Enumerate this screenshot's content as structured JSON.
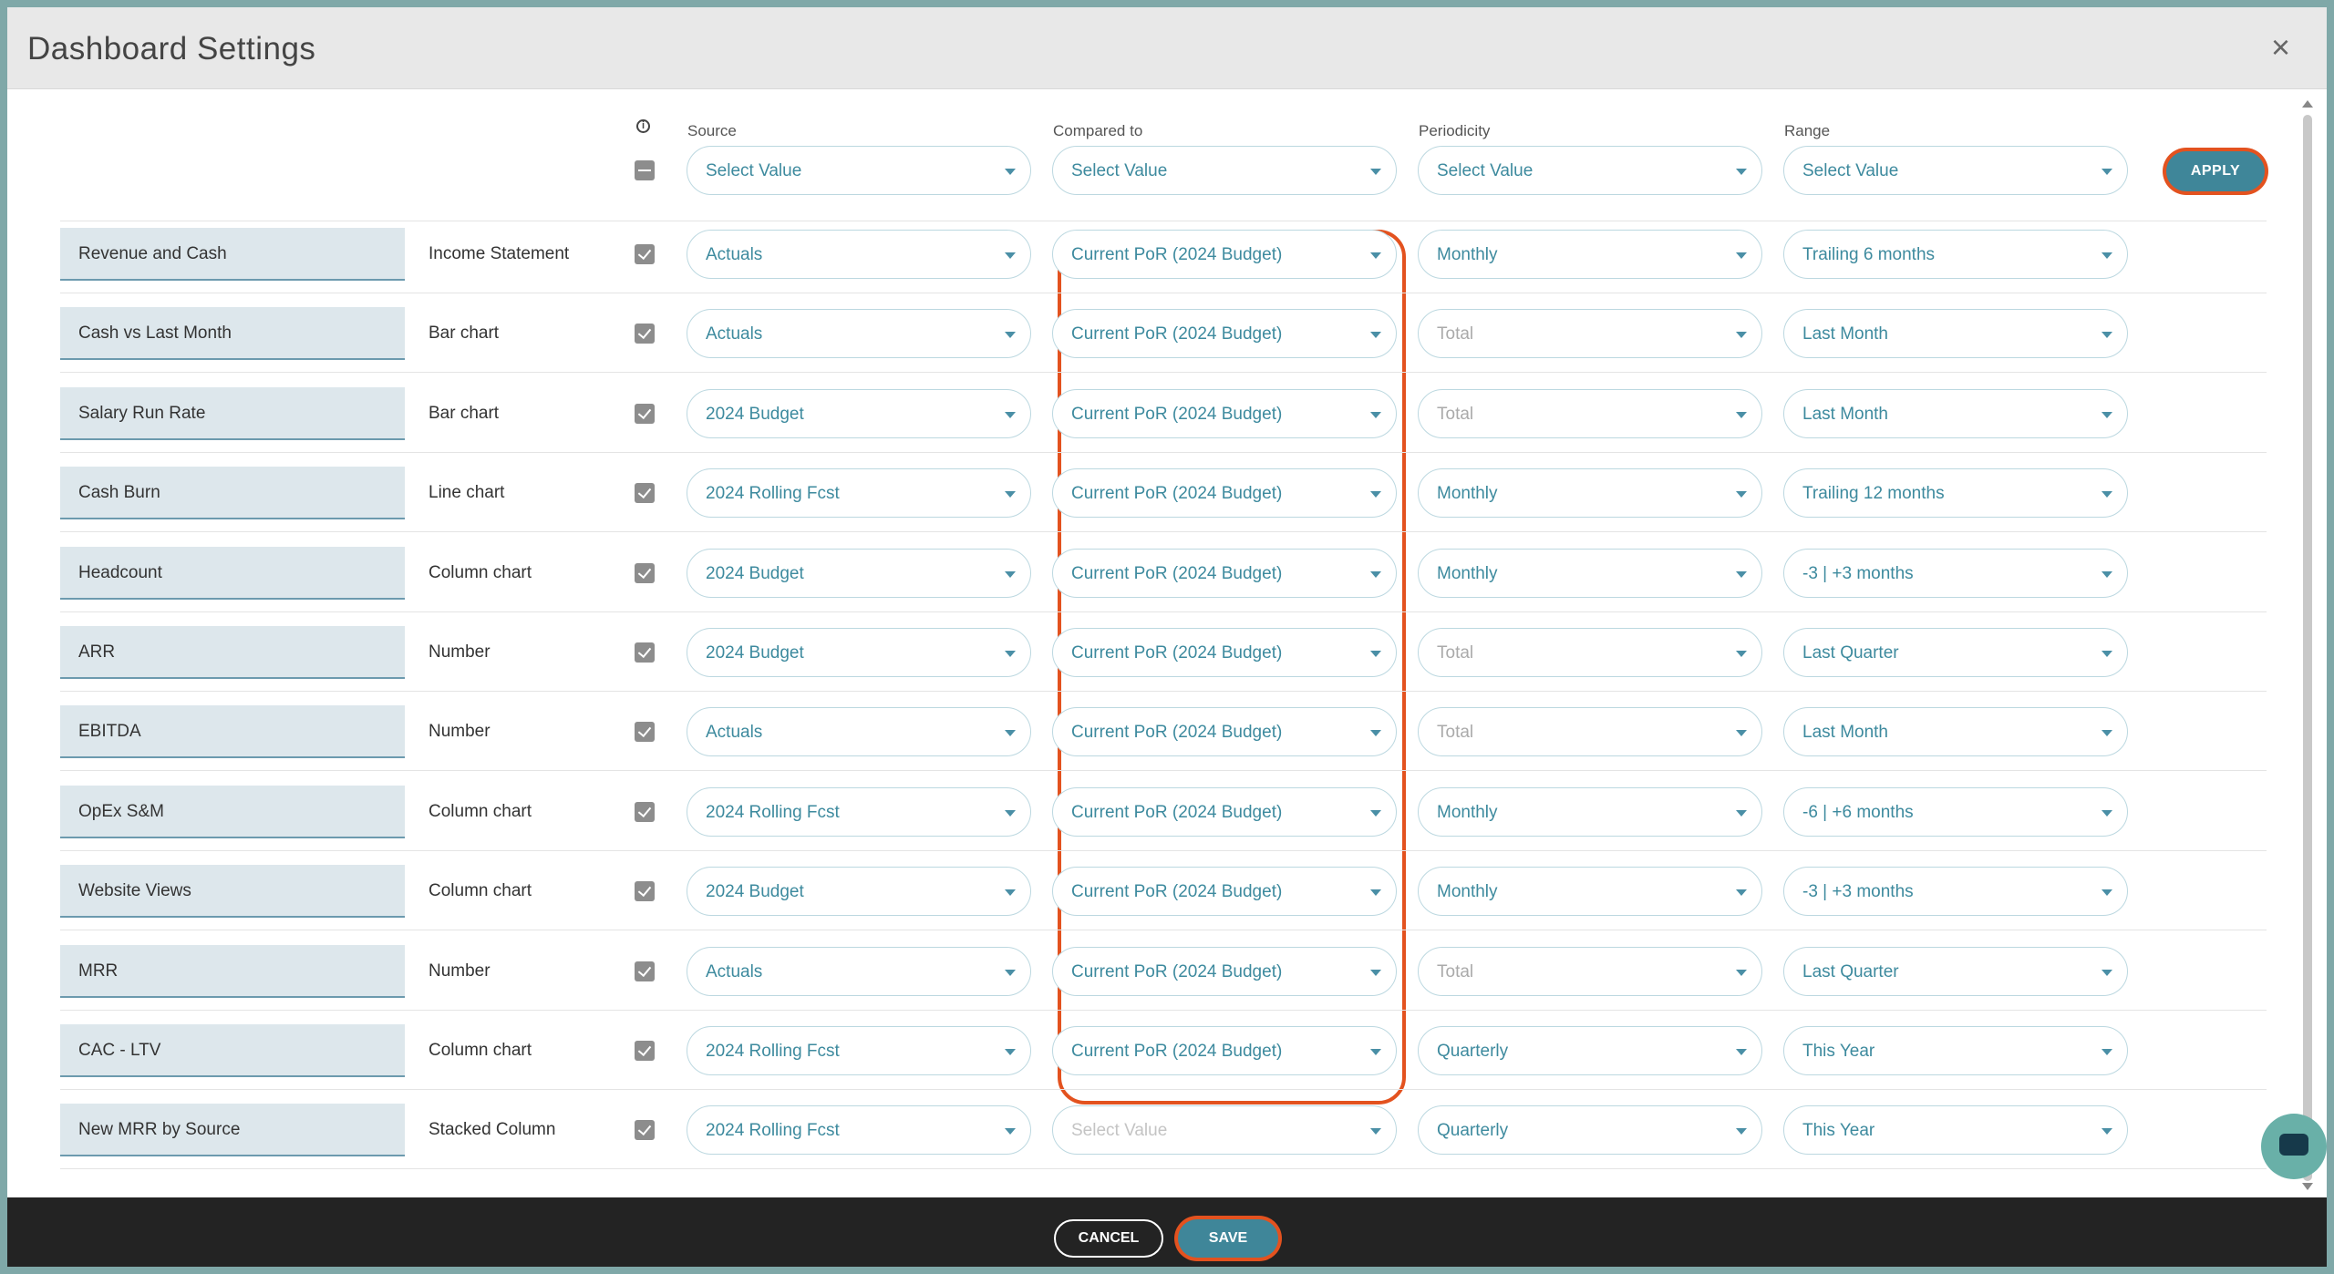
{
  "dialog": {
    "title": "Dashboard Settings",
    "close_icon": "close-icon"
  },
  "columns": {
    "info": "i",
    "source": "Source",
    "compared": "Compared to",
    "periodicity": "Periodicity",
    "range": "Range"
  },
  "filters": {
    "source": "Select Value",
    "compared": "Select Value",
    "periodicity": "Select Value",
    "range": "Select Value"
  },
  "apply_label": "APPLY",
  "rows": [
    {
      "name": "Revenue and Cash",
      "type": "Income Statement",
      "source": "Actuals",
      "compared": "Current PoR (2024 Budget)",
      "periodicity": "Monthly",
      "range": "Trailing 6 months"
    },
    {
      "name": "Cash vs Last Month",
      "type": "Bar chart",
      "source": "Actuals",
      "compared": "Current PoR (2024 Budget)",
      "periodicity": "Total",
      "range": "Last Month"
    },
    {
      "name": "Salary Run Rate",
      "type": "Bar chart",
      "source": "2024 Budget",
      "compared": "Current PoR (2024 Budget)",
      "periodicity": "Total",
      "range": "Last Month"
    },
    {
      "name": "Cash Burn",
      "type": "Line chart",
      "source": "2024 Rolling Fcst",
      "compared": "Current PoR (2024 Budget)",
      "periodicity": "Monthly",
      "range": "Trailing 12 months"
    },
    {
      "name": "Headcount",
      "type": "Column chart",
      "source": "2024 Budget",
      "compared": "Current PoR (2024 Budget)",
      "periodicity": "Monthly",
      "range": "-3 | +3 months"
    },
    {
      "name": "ARR",
      "type": "Number",
      "source": "2024 Budget",
      "compared": "Current PoR (2024 Budget)",
      "periodicity": "Total",
      "range": "Last Quarter"
    },
    {
      "name": "EBITDA",
      "type": "Number",
      "source": "Actuals",
      "compared": "Current PoR (2024 Budget)",
      "periodicity": "Total",
      "range": "Last Month"
    },
    {
      "name": "OpEx S&M",
      "type": "Column chart",
      "source": "2024 Rolling Fcst",
      "compared": "Current PoR (2024 Budget)",
      "periodicity": "Monthly",
      "range": "-6 | +6 months"
    },
    {
      "name": "Website Views",
      "type": "Column chart",
      "source": "2024 Budget",
      "compared": "Current PoR (2024 Budget)",
      "periodicity": "Monthly",
      "range": "-3 | +3 months"
    },
    {
      "name": "MRR",
      "type": "Number",
      "source": "Actuals",
      "compared": "Current PoR (2024 Budget)",
      "periodicity": "Total",
      "range": "Last Quarter"
    },
    {
      "name": "CAC - LTV",
      "type": "Column chart",
      "source": "2024 Rolling Fcst",
      "compared": "Current PoR (2024 Budget)",
      "periodicity": "Quarterly",
      "range": "This Year"
    },
    {
      "name": "New MRR by Source",
      "type": "Stacked Column",
      "source": "2024 Rolling Fcst",
      "compared": "Select Value",
      "periodicity": "Quarterly",
      "range": "This Year"
    }
  ],
  "footer": {
    "cancel_label": "CANCEL",
    "save_label": "SAVE"
  },
  "colors": {
    "accent": "#3f8699",
    "highlight": "#e3521f",
    "footer_bg": "#232323"
  }
}
